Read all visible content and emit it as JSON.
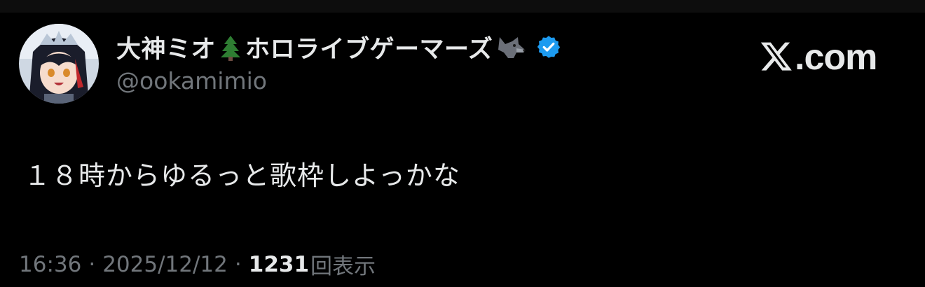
{
  "post": {
    "author": {
      "name_part1": "大神ミオ",
      "name_emoji1": "evergreen-tree-emoji",
      "name_part2": "ホロライブゲーマーズ",
      "name_emoji2": "wolf-emoji",
      "verified_icon": "verified-badge-icon",
      "verified_color": "#1d9bf0",
      "handle": "@ookamimio"
    },
    "text": "１８時からゆるっと歌枠しよっかな",
    "time": "16:36",
    "separator": "·",
    "date": "2025/12/12",
    "views_count": "1231",
    "views_label": "回表示"
  },
  "site": {
    "logo_icon": "x-logo-icon",
    "domain": ".com"
  },
  "colors": {
    "background": "#000000",
    "primary_text": "#e7e9ea",
    "secondary_text": "#71767b"
  }
}
